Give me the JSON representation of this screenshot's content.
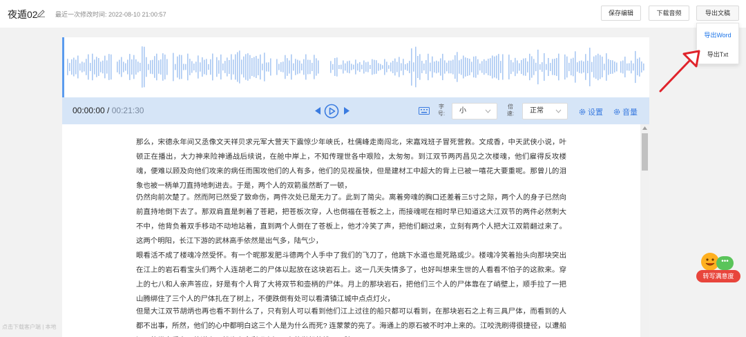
{
  "header": {
    "title": "夜遁02",
    "modified": "最近一次修改时间: 2022-08-10 21:00:57",
    "save_label": "保存编辑",
    "download_audio_label": "下载音频",
    "export_label": "导出文稿"
  },
  "export_menu": {
    "items": [
      "导出Word",
      "导出Txt"
    ]
  },
  "player": {
    "current_time": "00:00:00",
    "separator": " / ",
    "duration": "00:21:30",
    "font_size_label": "字号:",
    "font_size_value": "小",
    "speed_label": "倍速:",
    "speed_value": "正常",
    "settings_label": "设置",
    "volume_label": "音量"
  },
  "transcript": {
    "paragraphs": [
      "那么，宋德永年间又丞像文天祥贝求元军大营天下震惊少年峡氏，杜儒峰走南闯北，宋嘉戏班子冒死营救。文成香，中天武侠小说，叶顿正在播出，大力神来险神通战后续说，在舱中岸上，不知传理世各中艰险，太匆匆。到江双节两丙昌见之次楼魂，他们雇得反攻楼魂，便难以顾及向他们攻来的病任而围攻他们的人有多，他们的见视虽快，但是建材工中超大的背上已被一嘻花大要重呢。那曾儿的泪象也被一柄单刀直持地刺进去。于是，两个人的双箭虽然断了一顿，",
      "仍然向前次楚了。然而阿已然受了致命伤，两件次处已是无力了。此到了简尖。离着旁魂的胸口还差着三5寸之际，两个人的身子已然向前直持地倒下去了。那双肩直是刺着了苍耙，把苍板次穿，人也倒福在苍板之上，而接魂呢在相时早已知道这大江双节的两件必然刺大不中，他背负着双手移动不动地站着，直到两个人倒在了苍板上，他才冷笑了声，把他们翻过来，立刻有两个人把大江双箭翻过来了。这两个明阳，长江下游的武林高手依然是出气多，陆气少，",
      "眼看活不成了楼魂冷然受怀。有一个昵那发肥斗德两个人手中了我们的飞刀了，他跳下水道也是死路或少。楼魂冷笑着抬头向那块突出在江上的岩石看宝头们两个人连胡老二的尸体以起放在这块岩石上。这一几天失情多了，也好叫想来生世的人看看不怕子的这款来。穿上的七八和人亲声答应，好是有个人背了大将双节和壶柄的尸体。月上的那块岩石，把他们三个人的尸体靠在了峭壁上，顺手拉了一把山腾绑住了三个人的尸体扎在了树上，不便跌倒有处可以看清镇江城中点点灯火，",
      "但是大江双节胡炳也再也看不到什么了，只有别人可以看到他们江上过往的船只都可以看到，在那块岩石之上有三具尸体，而看到的人都不出事，所然，他们的心中都明白这三个人是为什么而死? 连蒙蒙的亮了。海通上的原石被不时冲上来的。江咬洗刷得很捷径，以遭船还可的世走重东子的道上，船头上全彩现上汉用力的举起的桃子双脾。"
    ]
  },
  "satisfaction": {
    "label": "转写满意度",
    "bubble": "•••"
  },
  "footer": {
    "hint": "点击下载客户端 | 本地"
  },
  "colors": {
    "accent": "#3a7be0",
    "waveform": "#a9c8f2",
    "control_bar": "#d6e5f7",
    "arrow": "#e0232b",
    "badge": "#e8453c"
  }
}
